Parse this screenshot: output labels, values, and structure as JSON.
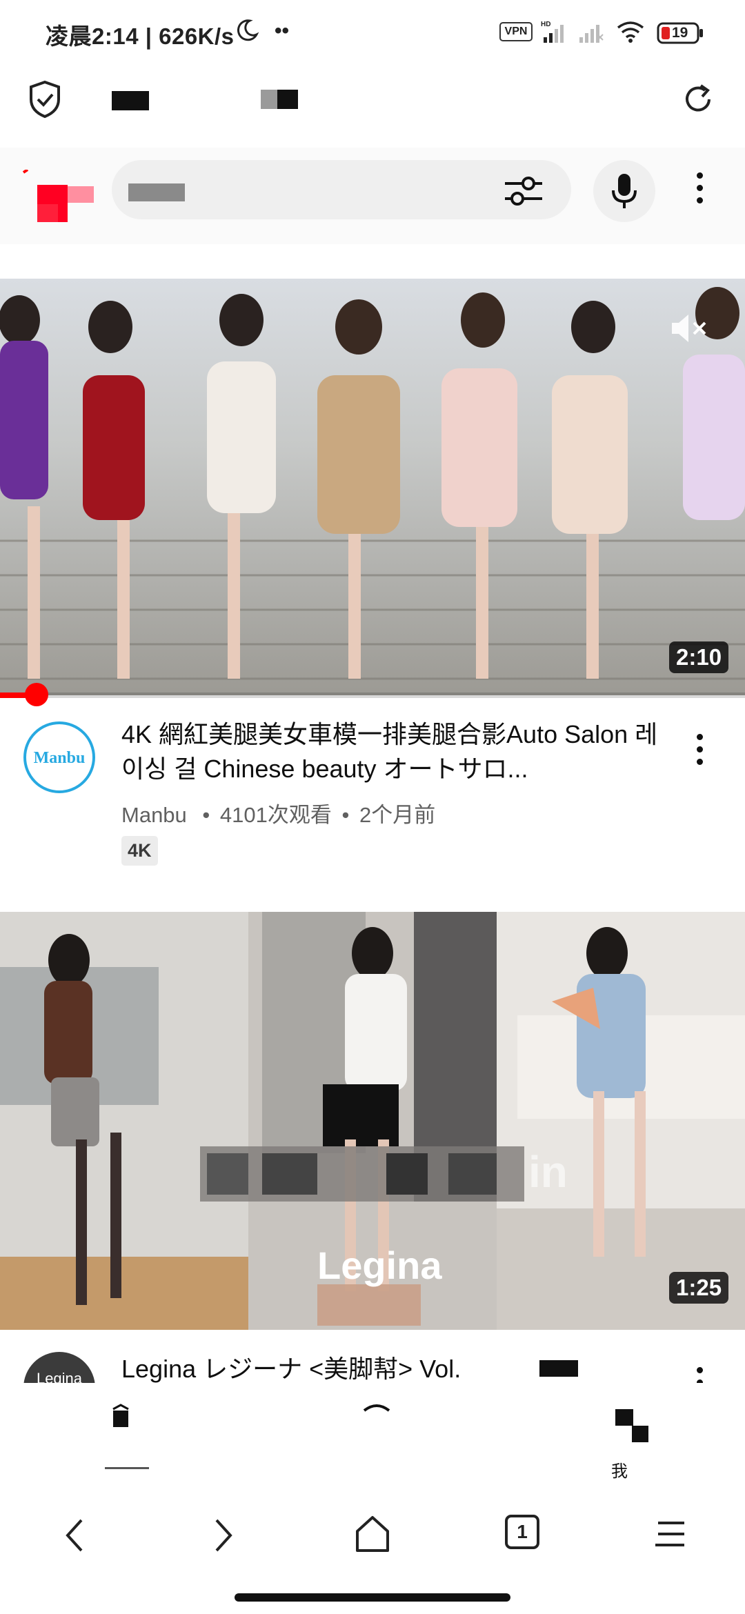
{
  "status_bar": {
    "time_speed": "凌晨2:14 | 626K/s",
    "vpn_label": "VPN",
    "battery_level": "19"
  },
  "search": {
    "placeholder": ""
  },
  "videos": [
    {
      "duration": "2:10",
      "title": "4K 網紅美腿美女車模一排美腿合影Auto Salon 레이싱 걸 Chinese beauty オートサロ...",
      "channel": "Manbu",
      "views": "4101次观看",
      "age": "2个月前",
      "badge": "4K",
      "avatar_text": "Manbu",
      "progress": 0.05
    },
    {
      "duration": "1:25",
      "title": "Legina レジーナ <美脚幇> Vol.",
      "avatar_text": "Legina",
      "overlay_text": "Legina",
      "overlay_partial": "in"
    }
  ],
  "bottom_nav": {
    "me_label": "我"
  },
  "browser_nav": {
    "tab_count": "1"
  },
  "colors": {
    "accent_red": "#ff0000",
    "avatar_blue": "#27a9e1",
    "text_secondary": "#606060"
  }
}
